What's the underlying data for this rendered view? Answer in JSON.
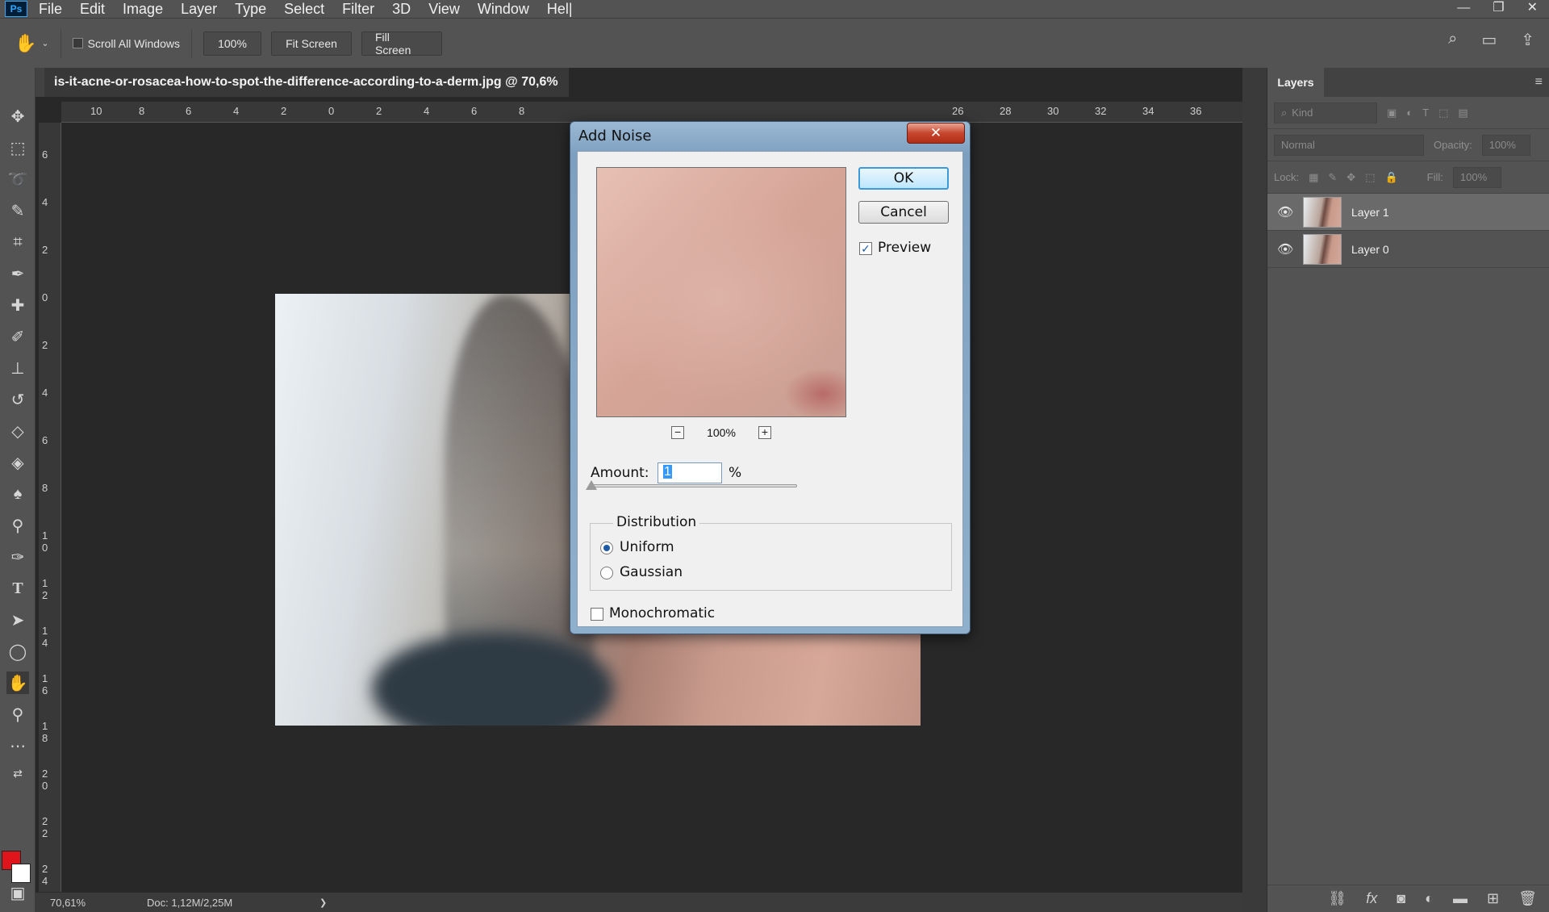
{
  "app": {
    "logo": "Ps",
    "menu": [
      "File",
      "Edit",
      "Image",
      "Layer",
      "Type",
      "Select",
      "Filter",
      "3D",
      "View",
      "Window",
      "Hel|"
    ]
  },
  "options_bar": {
    "scroll_all_windows": "Scroll All Windows",
    "zoom_btn": "100%",
    "fit_screen": "Fit Screen",
    "fill_screen": "Fill Screen"
  },
  "document": {
    "tab_title": "is-it-acne-or-rosacea-how-to-spot-the-difference-according-to-a-derm.jpg @ 70,6%",
    "ruler_h": [
      "10",
      "8",
      "6",
      "4",
      "2",
      "0",
      "2",
      "4",
      "6",
      "8",
      "26",
      "28",
      "30",
      "32",
      "34",
      "36"
    ],
    "ruler_v": [
      "6",
      "4",
      "2",
      "0",
      "2",
      "4",
      "6",
      "8",
      "1 0",
      "1 2",
      "1 4",
      "1 6",
      "1 8",
      "2 0",
      "2 2",
      "2 4"
    ]
  },
  "status": {
    "zoom": "70,61%",
    "doc": "Doc: 1,12M/2,25M",
    "arrow": "❯"
  },
  "dialog": {
    "title": "Add Noise",
    "close": "✕",
    "ok": "OK",
    "cancel": "Cancel",
    "preview_label": "Preview",
    "preview_checked": true,
    "preview_zoom": "100%",
    "amount_label": "Amount:",
    "amount_value": "1",
    "amount_unit": "%",
    "amount_slider_fraction": 0.002,
    "distribution_label": "Distribution",
    "uniform": "Uniform",
    "gaussian": "Gaussian",
    "selected_distribution": "Uniform",
    "monochromatic": "Monochromatic",
    "monochromatic_checked": false
  },
  "layers_panel": {
    "tab": "Layers",
    "kind": "Kind",
    "blend_mode": "Normal",
    "opacity_label": "Opacity:",
    "opacity_value": "100%",
    "lock_label": "Lock:",
    "fill_label": "Fill:",
    "fill_value": "100%",
    "layers": [
      {
        "name": "Layer 1",
        "active": true
      },
      {
        "name": "Layer 0",
        "active": false
      }
    ]
  },
  "colors": {
    "foreground": "#e0141b",
    "background": "#ffffff",
    "accent": "#31a8ff"
  }
}
